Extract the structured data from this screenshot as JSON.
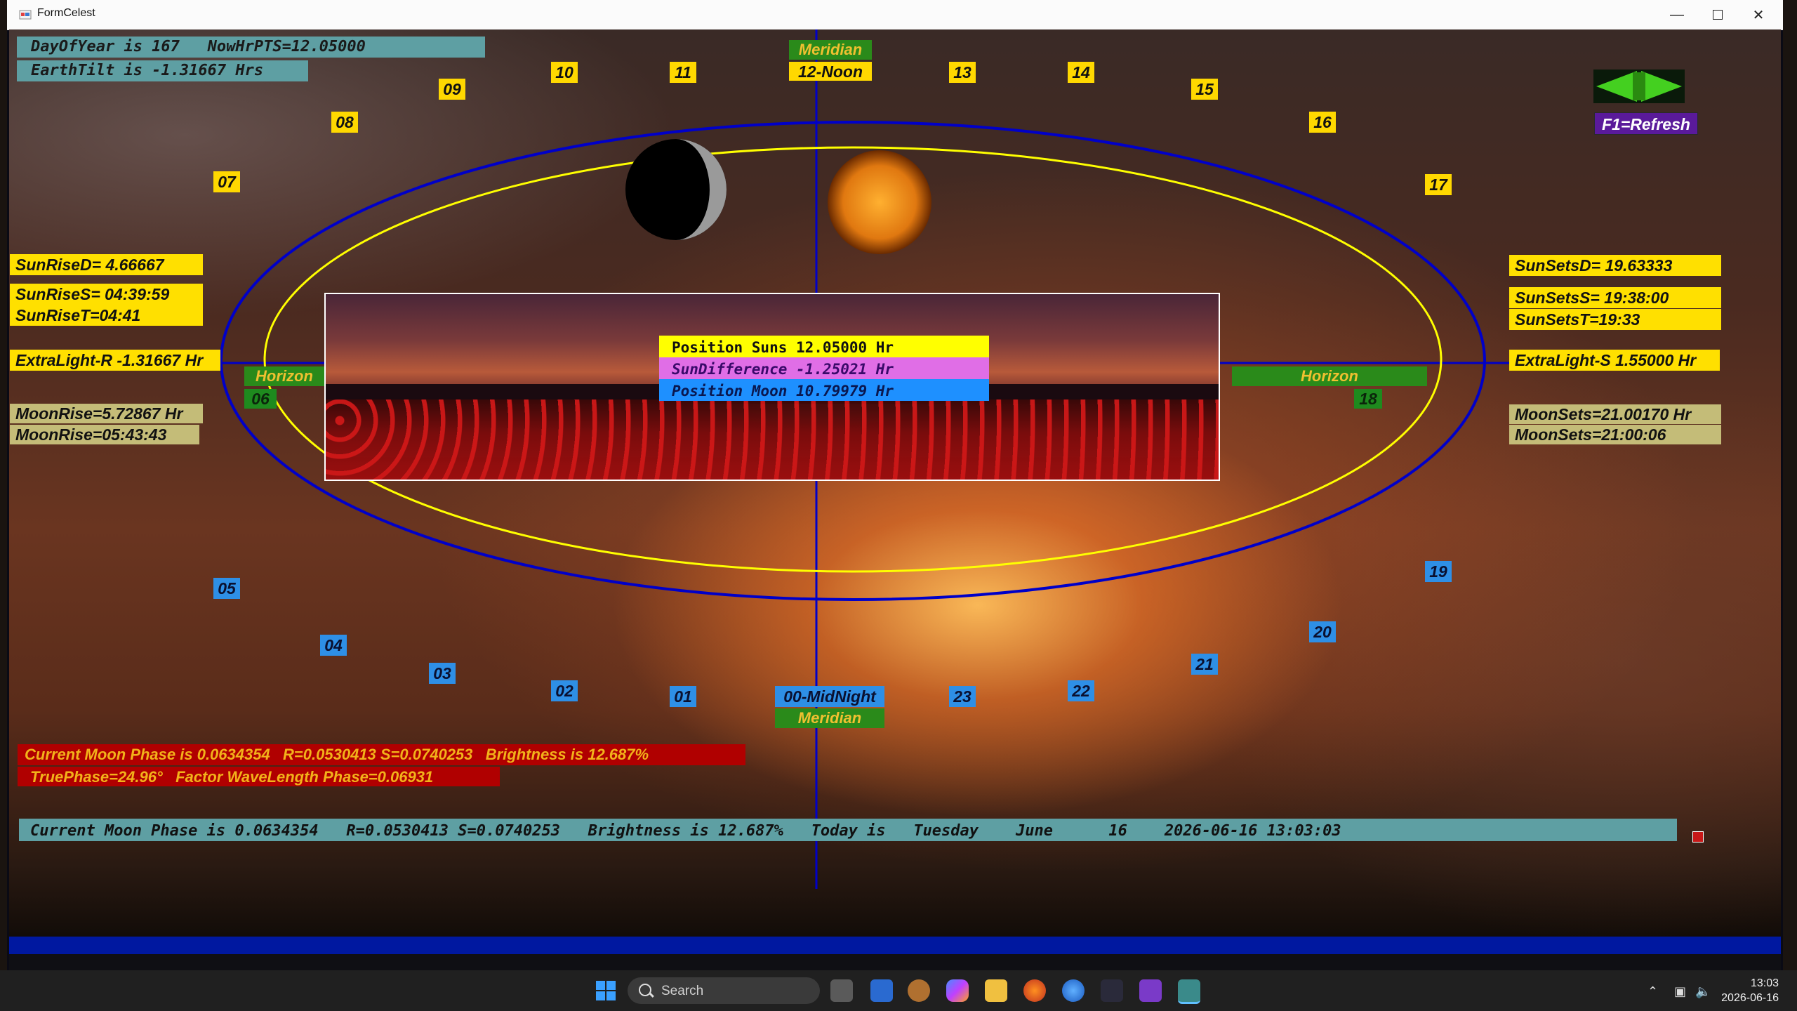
{
  "window": {
    "title": "FormCelest"
  },
  "info": {
    "day_of_year": "DayOfYear is 167   NowHrPTS=12.05000",
    "earth_tilt": "EarthTilt is -1.31667 Hrs"
  },
  "hours_day": [
    "07",
    "08",
    "09",
    "10",
    "11",
    "13",
    "14",
    "15",
    "16",
    "17"
  ],
  "hours_night": [
    "05",
    "04",
    "03",
    "02",
    "01",
    "23",
    "22",
    "21",
    "20",
    "19"
  ],
  "hours_horizon": [
    "06",
    "18"
  ],
  "meridian_top": {
    "label": "Meridian",
    "noon": "12-Noon"
  },
  "meridian_bottom": {
    "midnight": "00-MidNight",
    "label": "Meridian"
  },
  "horizon_label": "Horizon",
  "sun_rise": {
    "d": "SunRiseD= 4.66667",
    "s": "SunRiseS= 04:39:59",
    "t": "SunRiseT=04:41",
    "extra": "ExtraLight-R -1.31667 Hr"
  },
  "moon_rise": {
    "hr": "MoonRise=5.72867 Hr",
    "time": "MoonRise=05:43:43"
  },
  "sun_sets": {
    "d": "SunSetsD= 19.63333",
    "s": "SunSetsS= 19:38:00",
    "t": "SunSetsT=19:33",
    "extra": "ExtraLight-S 1.55000 Hr"
  },
  "moon_sets": {
    "hr": "MoonSets=21.00170 Hr",
    "time": "MoonSets=21:00:06"
  },
  "positions": {
    "suns": "Position Suns 12.05000 Hr",
    "diff": "SunDifference -1.25021 Hr",
    "moon": "Position Moon 10.79979 Hr"
  },
  "moon_phase": {
    "line1": "Current Moon Phase is 0.0634354   R=0.0530413 S=0.0740253   Brightness is 12.687%",
    "line2": "TruePhase=24.96°   Factor WaveLength Phase=0.06931"
  },
  "status_line": "Current Moon Phase is 0.0634354   R=0.0530413 S=0.0740253   Brightness is 12.687%   Today is   Tuesday    June      16    2026-06-16 13:03:03",
  "refresh": "F1=Refresh",
  "taskbar": {
    "search_placeholder": "Search",
    "time": "13:03",
    "date": "2026-06-16"
  },
  "colors": {
    "orbit_outer": "#0000c8",
    "orbit_inner": "#ffff00",
    "axis": "#0000c8"
  }
}
